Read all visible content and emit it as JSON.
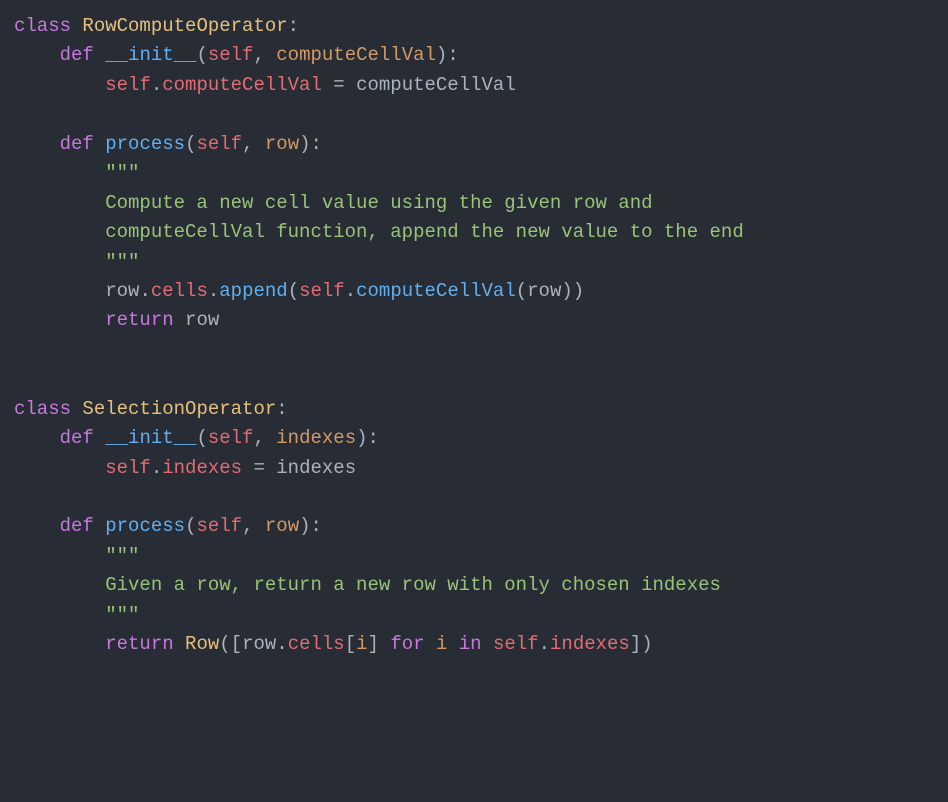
{
  "code": {
    "tokens": [
      [
        [
          "keyword",
          "class"
        ],
        [
          "ident",
          " "
        ],
        [
          "classname",
          "RowComputeOperator"
        ],
        [
          "punct",
          ":"
        ]
      ],
      [
        [
          "ident",
          "    "
        ],
        [
          "keyword",
          "def"
        ],
        [
          "ident",
          " "
        ],
        [
          "funcname",
          "__init__"
        ],
        [
          "punct",
          "("
        ],
        [
          "self",
          "self"
        ],
        [
          "punct",
          ", "
        ],
        [
          "param",
          "computeCellVal"
        ],
        [
          "punct",
          "):"
        ]
      ],
      [
        [
          "ident",
          "        "
        ],
        [
          "self",
          "self"
        ],
        [
          "punct",
          "."
        ],
        [
          "attr",
          "computeCellVal"
        ],
        [
          "punct",
          " = "
        ],
        [
          "ident",
          "computeCellVal"
        ]
      ],
      [],
      [
        [
          "ident",
          "    "
        ],
        [
          "keyword",
          "def"
        ],
        [
          "ident",
          " "
        ],
        [
          "funcname",
          "process"
        ],
        [
          "punct",
          "("
        ],
        [
          "self",
          "self"
        ],
        [
          "punct",
          ", "
        ],
        [
          "param",
          "row"
        ],
        [
          "punct",
          "):"
        ]
      ],
      [
        [
          "ident",
          "        "
        ],
        [
          "string",
          "\"\"\""
        ]
      ],
      [
        [
          "ident",
          "        "
        ],
        [
          "string",
          "Compute a new cell value using the given row and"
        ]
      ],
      [
        [
          "ident",
          "        "
        ],
        [
          "string",
          "computeCellVal function, append the new value to the end"
        ]
      ],
      [
        [
          "ident",
          "        "
        ],
        [
          "string",
          "\"\"\""
        ]
      ],
      [
        [
          "ident",
          "        "
        ],
        [
          "ident",
          "row"
        ],
        [
          "punct",
          "."
        ],
        [
          "attr",
          "cells"
        ],
        [
          "punct",
          "."
        ],
        [
          "funcname",
          "append"
        ],
        [
          "punct",
          "("
        ],
        [
          "self",
          "self"
        ],
        [
          "punct",
          "."
        ],
        [
          "funcname",
          "computeCellVal"
        ],
        [
          "punct",
          "("
        ],
        [
          "ident",
          "row"
        ],
        [
          "punct",
          "))"
        ]
      ],
      [
        [
          "ident",
          "        "
        ],
        [
          "keyword",
          "return"
        ],
        [
          "ident",
          " row"
        ]
      ],
      [],
      [],
      [
        [
          "keyword",
          "class"
        ],
        [
          "ident",
          " "
        ],
        [
          "classname",
          "SelectionOperator"
        ],
        [
          "punct",
          ":"
        ]
      ],
      [
        [
          "ident",
          "    "
        ],
        [
          "keyword",
          "def"
        ],
        [
          "ident",
          " "
        ],
        [
          "funcname",
          "__init__"
        ],
        [
          "punct",
          "("
        ],
        [
          "self",
          "self"
        ],
        [
          "punct",
          ", "
        ],
        [
          "param",
          "indexes"
        ],
        [
          "punct",
          "):"
        ]
      ],
      [
        [
          "ident",
          "        "
        ],
        [
          "self",
          "self"
        ],
        [
          "punct",
          "."
        ],
        [
          "attr",
          "indexes"
        ],
        [
          "punct",
          " = "
        ],
        [
          "ident",
          "indexes"
        ]
      ],
      [],
      [
        [
          "ident",
          "    "
        ],
        [
          "keyword",
          "def"
        ],
        [
          "ident",
          " "
        ],
        [
          "funcname",
          "process"
        ],
        [
          "punct",
          "("
        ],
        [
          "self",
          "self"
        ],
        [
          "punct",
          ", "
        ],
        [
          "param",
          "row"
        ],
        [
          "punct",
          "):"
        ]
      ],
      [
        [
          "ident",
          "        "
        ],
        [
          "string",
          "\"\"\""
        ]
      ],
      [
        [
          "ident",
          "        "
        ],
        [
          "string",
          "Given a row, return a new row with only chosen indexes"
        ]
      ],
      [
        [
          "ident",
          "        "
        ],
        [
          "string",
          "\"\"\""
        ]
      ],
      [
        [
          "ident",
          "        "
        ],
        [
          "keyword",
          "return"
        ],
        [
          "ident",
          " "
        ],
        [
          "classname",
          "Row"
        ],
        [
          "punct",
          "(["
        ],
        [
          "ident",
          "row"
        ],
        [
          "punct",
          "."
        ],
        [
          "attr",
          "cells"
        ],
        [
          "punct",
          "["
        ],
        [
          "param",
          "i"
        ],
        [
          "punct",
          "] "
        ],
        [
          "keyword",
          "for"
        ],
        [
          "ident",
          " "
        ],
        [
          "param",
          "i"
        ],
        [
          "ident",
          " "
        ],
        [
          "keyword",
          "in"
        ],
        [
          "ident",
          " "
        ],
        [
          "self",
          "self"
        ],
        [
          "punct",
          "."
        ],
        [
          "attr",
          "indexes"
        ],
        [
          "punct",
          "])"
        ]
      ]
    ]
  }
}
